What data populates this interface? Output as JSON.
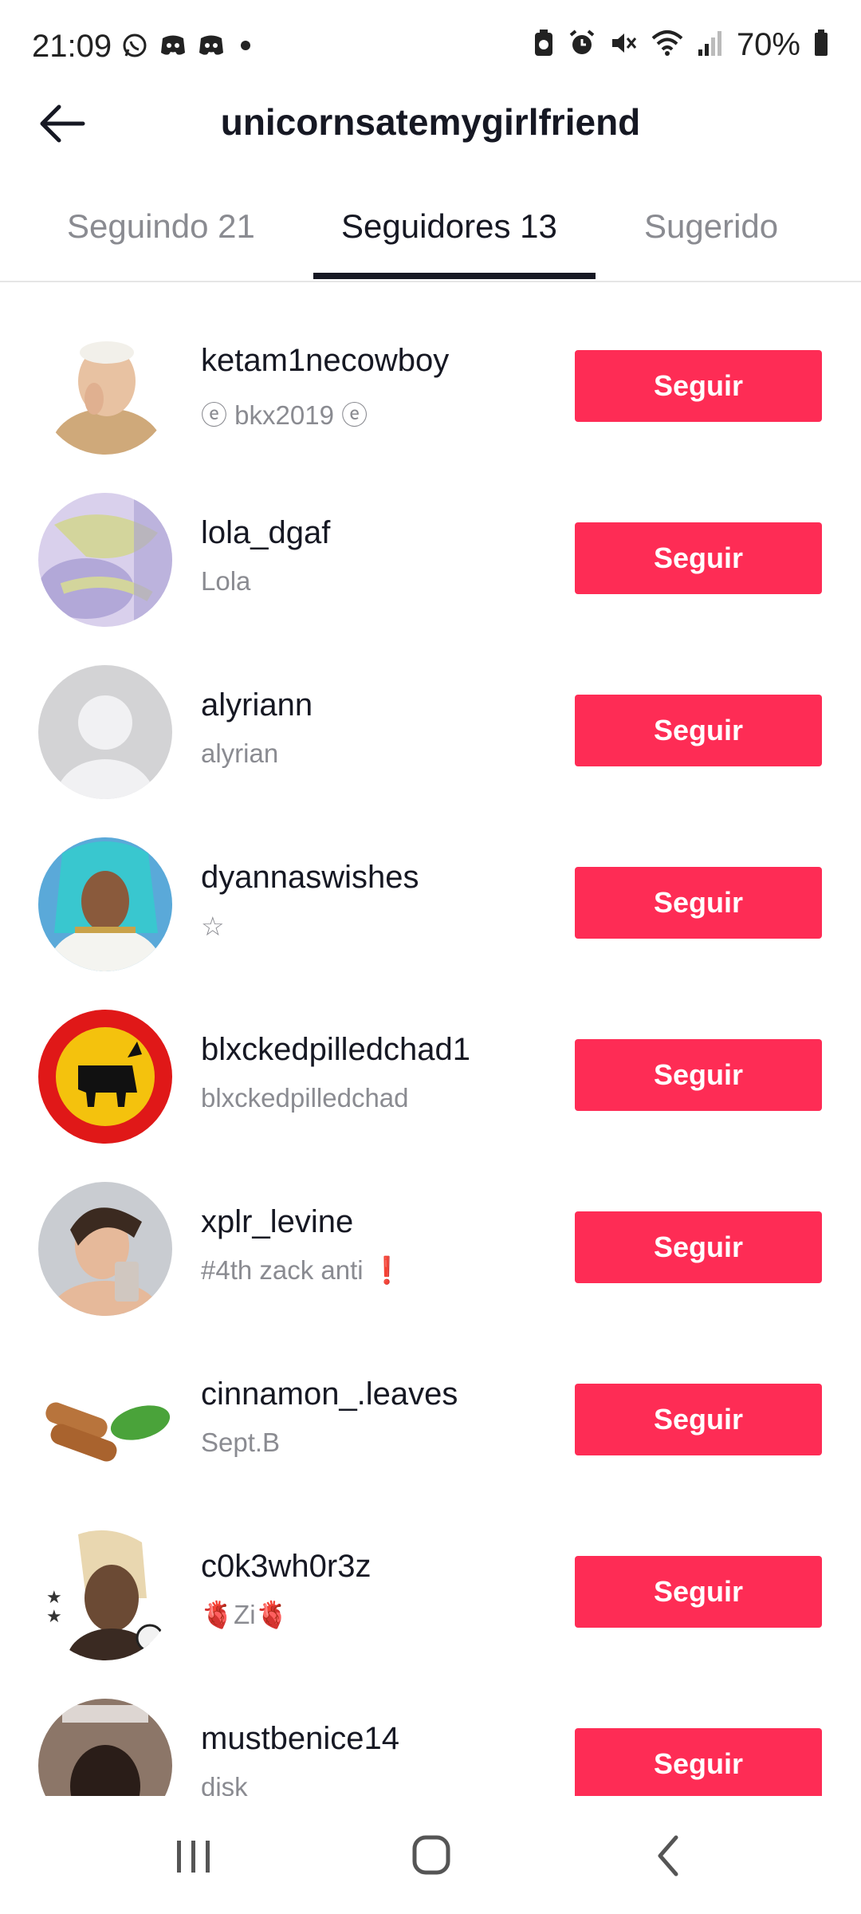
{
  "status_bar": {
    "time": "21:09",
    "left_icons": [
      "whatsapp-icon",
      "discord-icon",
      "discord-icon",
      "dot-icon"
    ],
    "right_icons": [
      "saver-icon",
      "alarm-icon",
      "mute-icon",
      "wifi-icon",
      "signal-icon",
      "battery-icon"
    ],
    "battery": "70%"
  },
  "header": {
    "title": "unicornsatemygirlfriend",
    "back_icon": "arrow-left-icon"
  },
  "tabs": [
    {
      "label": "Seguindo 21",
      "active": false
    },
    {
      "label": "Seguidores 13",
      "active": true
    },
    {
      "label": "Sugerido",
      "active": false
    }
  ],
  "followers": [
    {
      "username": "ketam1necowboy",
      "nickname": "ⓔ bkx2019 ⓔ",
      "button": "Seguir"
    },
    {
      "username": "lola_dgaf",
      "nickname": "Lola",
      "button": "Seguir"
    },
    {
      "username": "alyriann",
      "nickname": "alyrian",
      "button": "Seguir"
    },
    {
      "username": "dyannaswishes",
      "nickname": "☆",
      "button": "Seguir"
    },
    {
      "username": "blxckedpilledchad1",
      "nickname": "blxckedpilledchad",
      "button": "Seguir"
    },
    {
      "username": "xplr_levine",
      "nickname": "#4th zack anti ❗",
      "button": "Seguir"
    },
    {
      "username": "cinnamon_.leaves",
      "nickname": "Sept.B",
      "button": "Seguir"
    },
    {
      "username": "c0k3wh0r3z",
      "nickname": "🫀Zi🫀",
      "button": "Seguir"
    },
    {
      "username": "mustbenice14",
      "nickname": "disk",
      "button": "Seguir"
    }
  ],
  "nav_bar": {
    "icons": [
      "recent-apps-icon",
      "home-icon",
      "back-icon"
    ]
  },
  "colors": {
    "accent": "#fe2c55",
    "text_primary": "#161823",
    "text_secondary": "#8a8b91"
  }
}
